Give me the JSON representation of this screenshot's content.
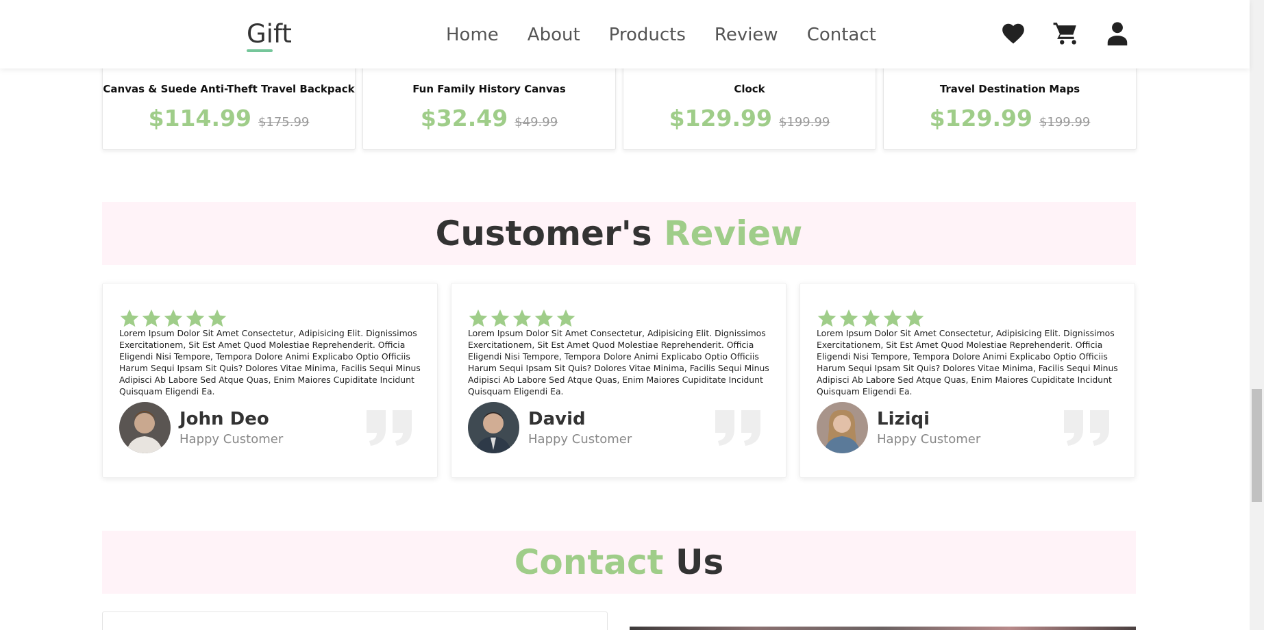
{
  "header": {
    "logo": "Gift",
    "nav": [
      "Home",
      "About",
      "Products",
      "Review",
      "Contact"
    ],
    "icons": [
      "heart-icon",
      "cart-icon",
      "user-icon"
    ]
  },
  "products": [
    {
      "name": "Canvas & Suede Anti-Theft Travel Backpack",
      "price": "$114.99",
      "old_price": "$175.99"
    },
    {
      "name": "Fun Family History Canvas",
      "price": "$32.49",
      "old_price": "$49.99"
    },
    {
      "name": "Clock",
      "price": "$129.99",
      "old_price": "$199.99"
    },
    {
      "name": "Travel Destination Maps",
      "price": "$129.99",
      "old_price": "$199.99"
    }
  ],
  "review_section": {
    "title_part1": "Customer's",
    "title_part2": "Review"
  },
  "reviews": [
    {
      "rating": 5,
      "text": "Lorem Ipsum Dolor Sit Amet Consectetur, Adipisicing Elit. Dignissimos Exercitationem, Sit Est Amet Quod Molestiae Reprehenderit. Officia Eligendi Nisi Tempore, Tempora Dolore Animi Explicabo Optio Officiis Harum Sequi Ipsam Sit Quis? Dolores Vitae Minima, Facilis Sequi Minus Adipisci Ab Labore Sed Atque Quas, Enim Maiores Cupiditate Incidunt Quisquam Eligendi Ea.",
      "name": "John Deo",
      "role": "Happy Customer"
    },
    {
      "rating": 5,
      "text": "Lorem Ipsum Dolor Sit Amet Consectetur, Adipisicing Elit. Dignissimos Exercitationem, Sit Est Amet Quod Molestiae Reprehenderit. Officia Eligendi Nisi Tempore, Tempora Dolore Animi Explicabo Optio Officiis Harum Sequi Ipsam Sit Quis? Dolores Vitae Minima, Facilis Sequi Minus Adipisci Ab Labore Sed Atque Quas, Enim Maiores Cupiditate Incidunt Quisquam Eligendi Ea.",
      "name": "David",
      "role": "Happy Customer"
    },
    {
      "rating": 5,
      "text": "Lorem Ipsum Dolor Sit Amet Consectetur, Adipisicing Elit. Dignissimos Exercitationem, Sit Est Amet Quod Molestiae Reprehenderit. Officia Eligendi Nisi Tempore, Tempora Dolore Animi Explicabo Optio Officiis Harum Sequi Ipsam Sit Quis? Dolores Vitae Minima, Facilis Sequi Minus Adipisci Ab Labore Sed Atque Quas, Enim Maiores Cupiditate Incidunt Quisquam Eligendi Ea.",
      "name": "Liziqi",
      "role": "Happy Customer"
    }
  ],
  "contact_section": {
    "title_part1": "Contact",
    "title_part2": "Us"
  },
  "colors": {
    "accent_green": "#9fcd89",
    "logo_underline": "#75c69a",
    "section_bg": "#fff3f8",
    "text_dark": "#333333"
  }
}
